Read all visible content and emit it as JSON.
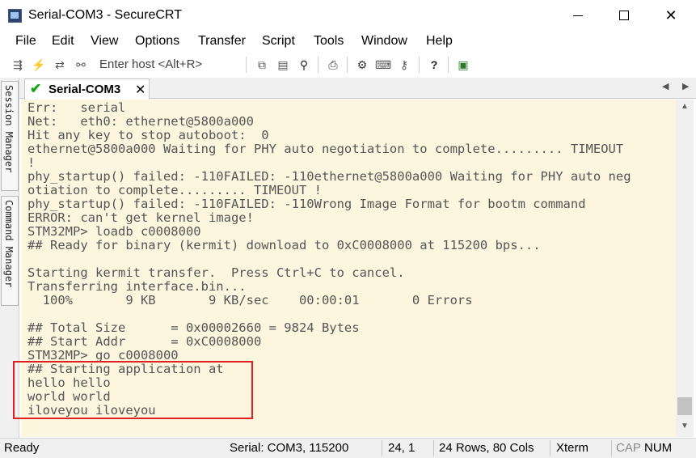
{
  "window": {
    "title": "Serial-COM3 - SecureCRT",
    "minimize_icon": "minimize-icon",
    "maximize_icon": "maximize-icon",
    "close_symbol": "✕"
  },
  "menu": [
    "File",
    "Edit",
    "View",
    "Options",
    "Transfer",
    "Script",
    "Tools",
    "Window",
    "Help"
  ],
  "toolbar": {
    "host_placeholder": "Enter host <Alt+R>",
    "icons": [
      "connect-icon",
      "quick-connect-icon",
      "reconnect-icon",
      "disconnect-icon",
      "copy-icon",
      "paste-icon",
      "find-icon",
      "print-icon",
      "settings-icon",
      "keymap-icon",
      "sftp-icon",
      "help-icon",
      "sessions-icon"
    ]
  },
  "side_panels": {
    "session_manager": "Session Manager",
    "command_manager": "Command Manager"
  },
  "session_tab": {
    "label": "Serial-COM3",
    "close_symbol": "✕",
    "status_color": "#19a319"
  },
  "terminal": {
    "background": "#fcf6de",
    "lines": [
      "Err:   serial",
      "Net:   eth0: ethernet@5800a000",
      "Hit any key to stop autoboot:  0",
      "ethernet@5800a000 Waiting for PHY auto negotiation to complete......... TIMEOUT",
      "!",
      "phy_startup() failed: -110FAILED: -110ethernet@5800a000 Waiting for PHY auto neg",
      "otiation to complete......... TIMEOUT !",
      "phy_startup() failed: -110FAILED: -110Wrong Image Format for bootm command",
      "ERROR: can't get kernel image!",
      "STM32MP> loadb c0008000",
      "## Ready for binary (kermit) download to 0xC0008000 at 115200 bps...",
      "",
      "Starting kermit transfer.  Press Ctrl+C to cancel.",
      "Transferring interface.bin...",
      "  100%       9 KB       9 KB/sec    00:00:01       0 Errors",
      "",
      "## Total Size      = 0x00002660 = 9824 Bytes",
      "## Start Addr      = 0xC0008000",
      "STM32MP> go c0008000",
      "## Starting application at",
      "hello hello",
      "world world",
      "iloveyou iloveyou"
    ],
    "highlight_color": "#e02020"
  },
  "status_bar": {
    "ready": "Ready",
    "connection": "Serial: COM3, 115200",
    "cursor": "24,  1",
    "size": "24 Rows, 80 Cols",
    "terminal_type": "Xterm",
    "cap": "CAP",
    "num": "NUM"
  }
}
